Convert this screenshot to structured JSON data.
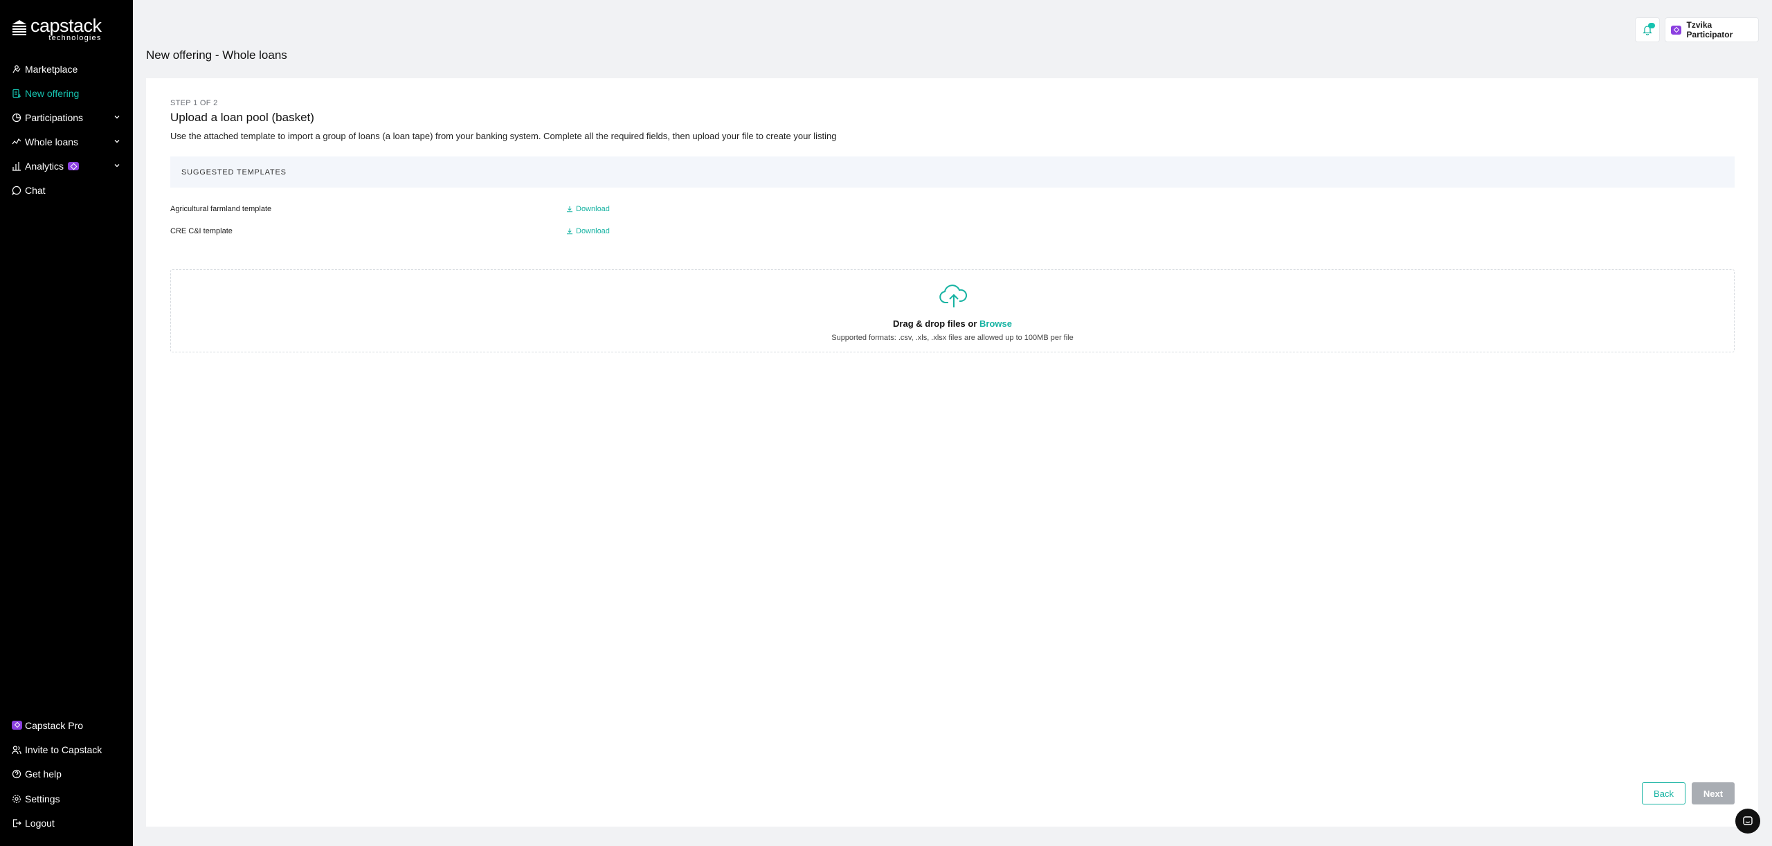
{
  "app": {
    "logo_name": "capstack",
    "logo_sub": "technologies"
  },
  "sidebar": {
    "items": [
      {
        "label": "Marketplace",
        "icon": "handshake-icon"
      },
      {
        "label": "New offering",
        "icon": "document-icon",
        "active": true
      },
      {
        "label": "Participations",
        "icon": "pie-icon"
      },
      {
        "label": "Whole loans",
        "icon": "trend-icon"
      },
      {
        "label": "Analytics",
        "icon": "bar-chart-icon",
        "badge": "pro"
      },
      {
        "label": "Chat",
        "icon": "chat-icon"
      }
    ],
    "bottom": [
      {
        "label": "Capstack Pro",
        "icon": "pro-icon"
      },
      {
        "label": "Invite to Capstack",
        "icon": "users-icon"
      },
      {
        "label": "Get help",
        "icon": "help-icon"
      },
      {
        "label": "Settings",
        "icon": "gear-icon"
      },
      {
        "label": "Logout",
        "icon": "logout-icon"
      }
    ]
  },
  "header": {
    "title": "New offering - Whole loans",
    "user_name": "Tzvika Participator"
  },
  "main": {
    "step": "STEP 1 OF 2",
    "heading": "Upload a loan pool (basket)",
    "description": "Use the attached template to import a group of loans (a loan tape) from your banking system. Complete all the required fields, then upload your file to create your listing",
    "templates_header": "SUGGESTED TEMPLATES",
    "templates": [
      {
        "name": "Agricultural farmland template",
        "action": "Download"
      },
      {
        "name": "CRE C&I template",
        "action": "Download"
      }
    ],
    "dropzone": {
      "title_prefix": "Drag & drop files or ",
      "browse": "Browse",
      "subtitle": "Supported formats: .csv, .xls, .xlsx files are allowed up to 100MB per file"
    },
    "back_label": "Back",
    "next_label": "Next"
  },
  "colors": {
    "accent": "#16b3a2",
    "sidebar_bg": "#000000",
    "pro": "#8b3fe0",
    "disabled": "#a9adb3"
  }
}
